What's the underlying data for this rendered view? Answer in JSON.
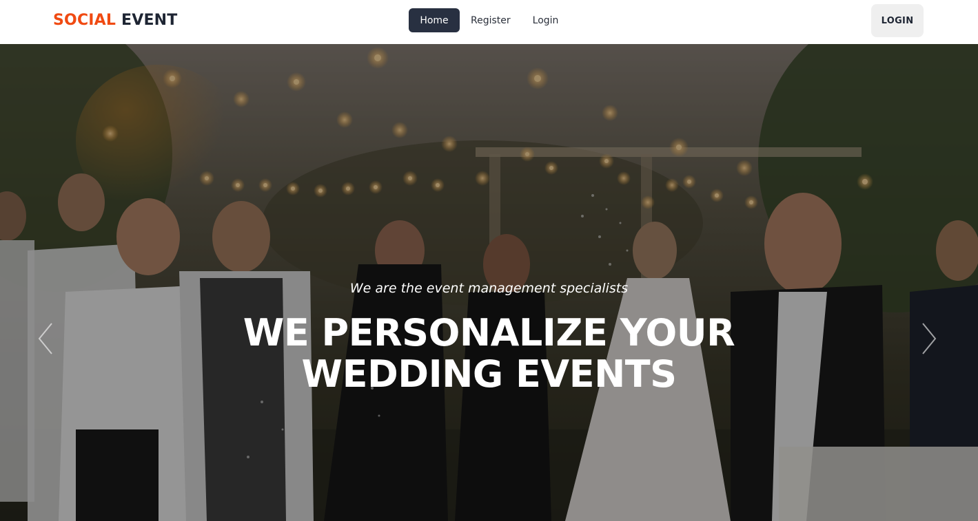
{
  "brand": {
    "part1": "SOCIAL",
    "part2": "EVENT",
    "part1_color": "#f04a12",
    "part2_color": "#1e2533"
  },
  "nav": {
    "items": [
      {
        "label": "Home",
        "active": true
      },
      {
        "label": "Register",
        "active": false
      },
      {
        "label": "Login",
        "active": false
      }
    ]
  },
  "header_button": {
    "label": "LOGIN"
  },
  "hero": {
    "subtitle": "We are the event management specialists",
    "headline_line1": "WE PERSONALIZE YOUR",
    "headline_line2": "WEDDING EVENTS",
    "prev_icon": "chevron-left-icon",
    "next_icon": "chevron-right-icon"
  },
  "colors": {
    "nav_active_bg": "#283041",
    "login_btn_bg": "#efefef"
  }
}
